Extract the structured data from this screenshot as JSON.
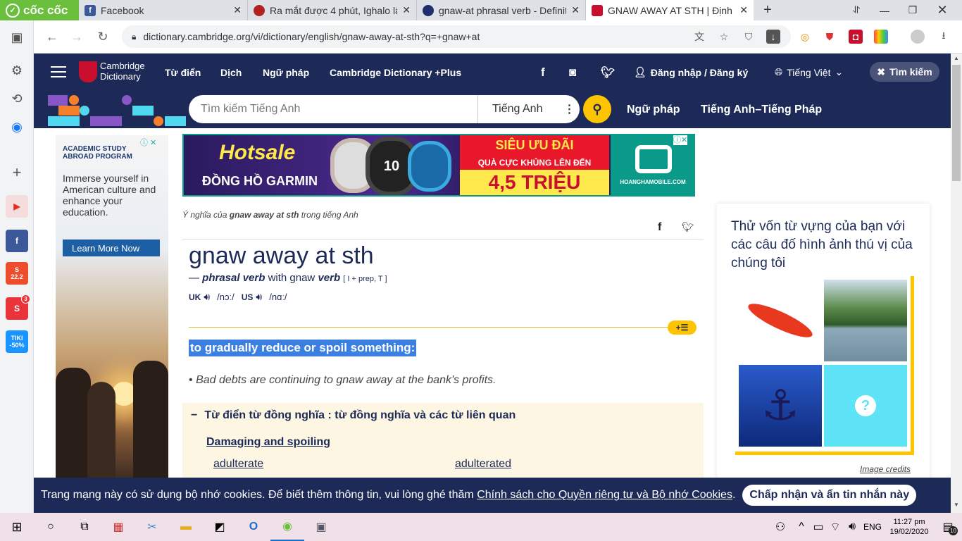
{
  "browser": {
    "brand": "cốc cốc",
    "tabs": [
      {
        "title": "Facebook",
        "favicon": "facebook-icon",
        "color": "#3b5998"
      },
      {
        "title": "Ra mắt được 4 phút, Ighalo lậ",
        "favicon": "news-icon",
        "color": "#b22222"
      },
      {
        "title": "gnaw-at phrasal verb - Definit",
        "favicon": "oxford-icon",
        "color": "#1f2f6b"
      },
      {
        "title": "GNAW AWAY AT STH | Định n",
        "favicon": "cambridge-icon",
        "color": "#c8102e"
      }
    ],
    "url": "dictionary.cambridge.org/vi/dictionary/english/gnaw-away-at-sth?q=+gnaw+at"
  },
  "site": {
    "logo_line1": "Cambridge",
    "logo_line2": "Dictionary",
    "menu": [
      "Từ điển",
      "Dịch",
      "Ngữ pháp",
      "Cambridge Dictionary +Plus"
    ],
    "login": "Đăng nhập / Đăng ký",
    "language": "Tiếng Việt",
    "search_close": "Tìm kiếm",
    "search_placeholder": "Tìm kiếm Tiếng Anh",
    "search_lang": "Tiếng Anh",
    "nav2_links": [
      "Ngữ pháp",
      "Tiếng Anh–Tiếng Pháp"
    ]
  },
  "left_ad": {
    "kicker": "ACADEMIC STUDY ABROAD PROGRAM",
    "text": "Immerse yourself in American culture and enhance your education.",
    "cta": "Learn More Now"
  },
  "banner_ad": {
    "hotsale": "Hotsale",
    "product": "ĐỒNG HỒ GARMIN",
    "promo": "SIÊU ƯU ĐÃI",
    "promo2": "QUÀ CỰC KHỦNG LÊN ĐẾN",
    "amount": "4,5 TRIỆU",
    "shop": "HOANGHAMOBILE.COM"
  },
  "entry": {
    "crumb_pre": "Ý nghĩa của",
    "crumb_word": "gnaw away at sth",
    "crumb_post": "trong tiếng Anh",
    "headword": "gnaw away at sth",
    "pos_dash": "—",
    "pos1": "phrasal verb",
    "pos_with": "with gnaw",
    "pos2": "verb",
    "grammar": "[ I + prep, T ]",
    "uk": "UK",
    "uk_ipa": "/nɔː/",
    "us": "US",
    "us_ipa": "/nɑː/",
    "definition": "to gradually reduce or spoil something:",
    "example": "Bad debts are continuing to gnaw away at the bank's profits.",
    "thesaurus_title": "Từ điển từ đồng nghĩa : từ đồng nghĩa và các từ liên quan",
    "thesaurus_group": "Damaging and spoiling",
    "thesaurus_words": [
      "adulterate",
      "adulterated"
    ]
  },
  "quiz": {
    "title": "Thử vốn từ vựng của bạn với các câu đố hình ảnh thú vị của chúng tôi",
    "credits": "Image credits"
  },
  "cookie": {
    "text": "Trang mạng này có sử dụng bộ nhớ cookies. Để biết thêm thông tin, vui lòng ghé thăm ",
    "link": "Chính sách cho Quyền riêng tư và Bộ nhớ Cookies",
    "end": ".",
    "button": "Chấp nhận và ẩn tin nhắn này"
  },
  "taskbar": {
    "lang": "ENG",
    "time": "11:27 pm",
    "date": "19/02/2020",
    "notifications": "10"
  },
  "sidebar_badges": {
    "shopee": "22.2",
    "notif": "3",
    "tiki_line1": "TIKI",
    "tiki_line2": "-50%"
  }
}
